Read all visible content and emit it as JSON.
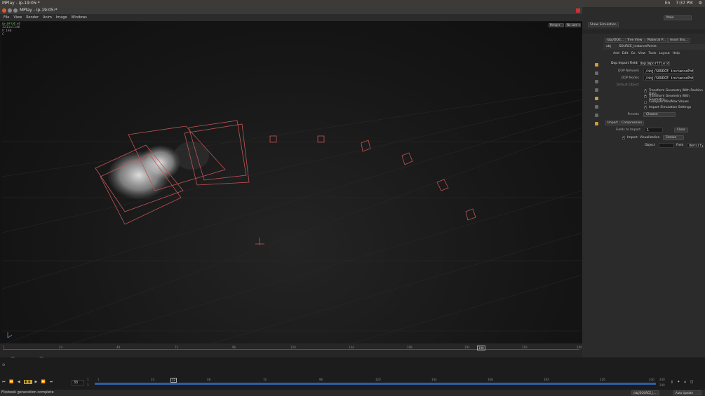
{
  "os_bar": {
    "title": "MPlay - ip-19:05:*",
    "clock": "7:37 PM",
    "lang": "En"
  },
  "mplay": {
    "title": "MPlay - ip-19:05:*",
    "menu": [
      "File",
      "View",
      "Render",
      "Anim",
      "Image",
      "Windows"
    ],
    "overlay": {
      "line1": "ip-19:04:34",
      "line2": "1211x1146",
      "line3": "fr 198",
      "line4": "C"
    },
    "viewport_buttons": {
      "persp": "Persp ▾",
      "cam": "No cam ▾"
    },
    "timeline": {
      "ticks": [
        "1",
        "24",
        "48",
        "72",
        "96",
        "120",
        "144",
        "168",
        "192",
        "198",
        "216",
        "240"
      ],
      "current_frame": "198",
      "frame_field": "198",
      "start_field": "1",
      "end_field": "240",
      "fps": "24"
    }
  },
  "main_timeline": {
    "ticks": [
      "1",
      "12",
      "24",
      "48",
      "72",
      "96",
      "120",
      "144",
      "168",
      "192",
      "216",
      "240"
    ],
    "current": "12",
    "frame_field": "33",
    "start": "1",
    "start2": "1",
    "end": "240",
    "end2": "240",
    "auto_update": "Auto Update",
    "path": "/obj/SOURCE_i..."
  },
  "status": {
    "text": "Flipbook generation complete"
  },
  "right_panel": {
    "top_tabs": {
      "main_label": "Main",
      "show_sim": "Show Simulation"
    },
    "pane_tabs": [
      "/obj/OOE...",
      "Tree View",
      "Material P...",
      "Asset Bro..."
    ],
    "path_label": "obj",
    "node_path": "SOURCE_instancePoints",
    "menu": [
      "Add",
      "Edit",
      "Go",
      "View",
      "Tools",
      "Layout",
      "Help"
    ],
    "node_type": "Dop Import Fields",
    "node_name": "dopimportfield1",
    "params": {
      "dop_network_label": "DOP Network",
      "dop_network_value": "/obj/SOURCE_instancePntr",
      "dop_nodes_label": "DOP Nodes",
      "dop_nodes_value": "/obj/SOURCE_instancePntr",
      "default_object_label": "Default Object",
      "checks": [
        "Transform Geometry With Position Data",
        "Transform Geometry With Geometry...",
        "Compute Min/Max Values",
        "Import Simulation Settings"
      ],
      "checks_on": [
        true,
        true,
        false,
        true
      ],
      "presets_label": "Presets",
      "presets_value": "Choose",
      "tabs": [
        "Import",
        "Compression"
      ],
      "fields_label": "Fields to Import",
      "fields_value": "1",
      "clear_label": "Clear",
      "import_label": "Import",
      "visualization_label": "Visualization",
      "visualization_value": "Smoke",
      "object_label": "Object",
      "field_label": "Field",
      "field_value": "density"
    }
  }
}
